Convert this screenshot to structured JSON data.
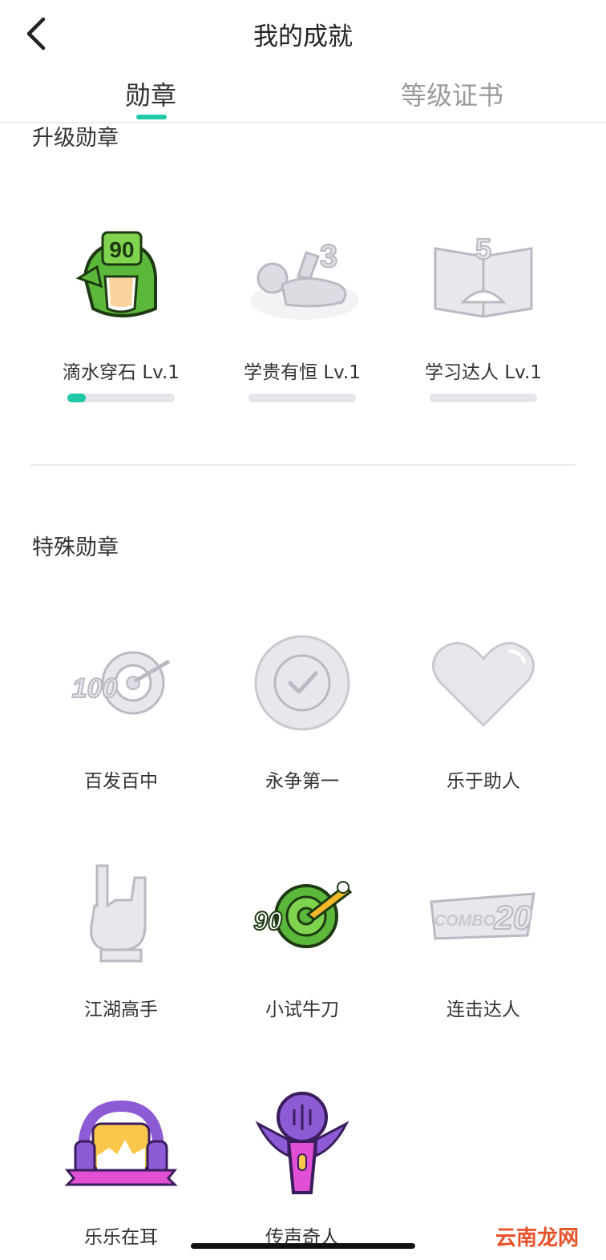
{
  "header": {
    "title": "我的成就",
    "back_icon": "chevron-left-icon"
  },
  "tabs": [
    {
      "label": "勋章",
      "active": true
    },
    {
      "label": "等级证书",
      "active": false
    }
  ],
  "upgrade_section": {
    "title": "升级勋章",
    "badges": [
      {
        "label": "滴水穿石 Lv.1",
        "icon": "tongue-90-badge-icon",
        "progress": 0.17
      },
      {
        "label": "学贵有恒 Lv.1",
        "icon": "reclining-figure-badge-icon",
        "progress": 0
      },
      {
        "label": "学习达人 Lv.1",
        "icon": "open-book-badge-icon",
        "progress": 0
      }
    ]
  },
  "special_section": {
    "title": "特殊勋章",
    "badges": [
      {
        "label": "百发百中",
        "icon": "target-100-badge-icon"
      },
      {
        "label": "永争第一",
        "icon": "check-circle-badge-icon"
      },
      {
        "label": "乐于助人",
        "icon": "heart-badge-icon"
      },
      {
        "label": "江湖高手",
        "icon": "rock-hand-badge-icon"
      },
      {
        "label": "小试牛刀",
        "icon": "target-90-badge-icon"
      },
      {
        "label": "连击达人",
        "icon": "combo-20-badge-icon"
      },
      {
        "label": "乐乐在耳",
        "icon": "headphones-badge-icon"
      },
      {
        "label": "传声奇人",
        "icon": "microphone-badge-icon"
      }
    ]
  },
  "watermark": "云南龙网",
  "colors": {
    "accent": "#20c9a6",
    "locked_gray": "#dcdde2",
    "green": "#5cb83a",
    "purple": "#8d5bd6"
  }
}
